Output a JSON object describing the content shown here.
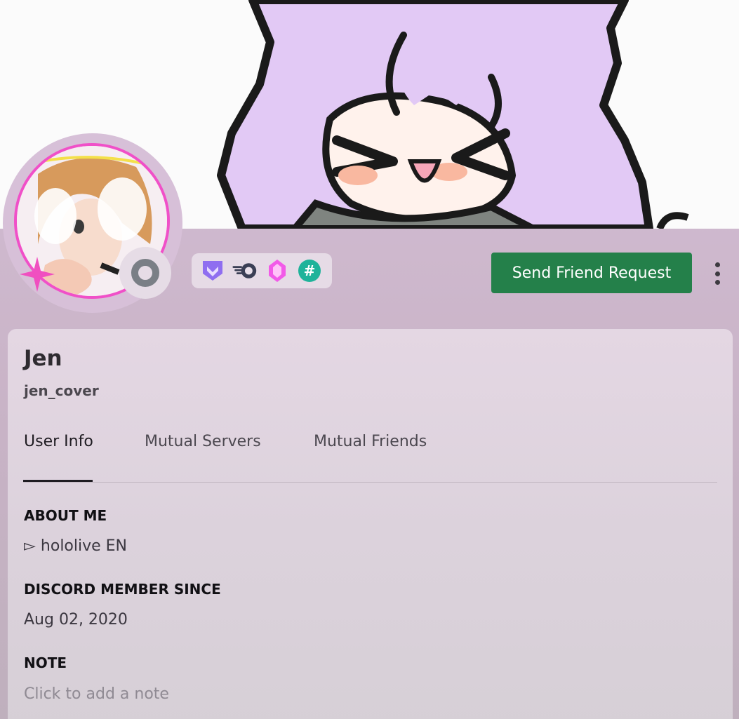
{
  "profile": {
    "display_name": "Jen",
    "username": "jen_cover"
  },
  "actions": {
    "friend_request_label": "Send Friend Request",
    "more_icon": "vertical-ellipsis-icon"
  },
  "status": {
    "state_icon": "offline-status-icon"
  },
  "badges": [
    {
      "icon": "hypesquad-balance-badge-icon"
    },
    {
      "icon": "nitro-boost-badge-icon"
    },
    {
      "icon": "server-booster-gem-badge-icon"
    },
    {
      "icon": "hashtag-badge-icon"
    }
  ],
  "tabs": [
    {
      "label": "User Info",
      "active": true
    },
    {
      "label": "Mutual Servers",
      "active": false
    },
    {
      "label": "Mutual Friends",
      "active": false
    }
  ],
  "sections": {
    "about_title": "ABOUT ME",
    "about_text": "▻ hololive EN",
    "member_since_title": "DISCORD MEMBER SINCE",
    "member_since_value": "Aug 02, 2020",
    "note_title": "NOTE",
    "note_placeholder": "Click to add a note"
  },
  "colors": {
    "accent_button": "#24804a",
    "avatar_ring": "#f050c8",
    "profile_theme": "#d6bfd7"
  }
}
